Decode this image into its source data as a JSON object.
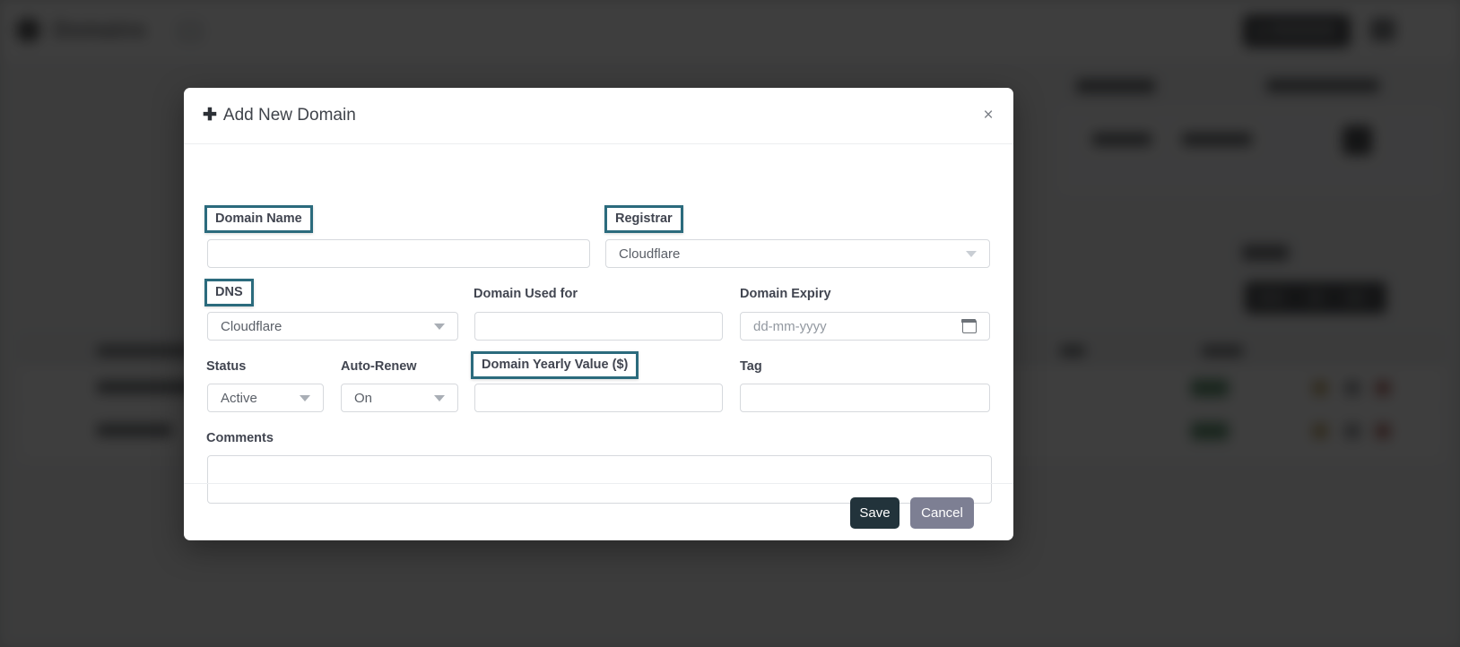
{
  "background": {
    "app_title": "Domains",
    "status_badge_color": "#1f7a3e",
    "primary_button_color": "#0d1117"
  },
  "modal": {
    "title": "Add New Domain",
    "title_icon": "plus-icon",
    "close_icon": "×",
    "fields": {
      "domain_name": {
        "label": "Domain Name",
        "value": "",
        "placeholder": "",
        "highlighted": true
      },
      "registrar": {
        "label": "Registrar",
        "value": "Cloudflare",
        "highlighted": true
      },
      "dns": {
        "label": "DNS",
        "value": "Cloudflare",
        "highlighted": true
      },
      "domain_used_for": {
        "label": "Domain Used for",
        "value": "",
        "placeholder": "",
        "highlighted": false
      },
      "domain_expiry": {
        "label": "Domain Expiry",
        "value": "",
        "placeholder": "dd-mm-yyyy",
        "highlighted": false
      },
      "status": {
        "label": "Status",
        "value": "Active",
        "highlighted": false
      },
      "auto_renew": {
        "label": "Auto-Renew",
        "value": "On",
        "highlighted": false
      },
      "domain_yearly_value": {
        "label": "Domain Yearly Value ($)",
        "value": "",
        "placeholder": "",
        "highlighted": true
      },
      "tag": {
        "label": "Tag",
        "value": "",
        "placeholder": "",
        "highlighted": false
      },
      "comments": {
        "label": "Comments",
        "value": "",
        "placeholder": "",
        "highlighted": false
      }
    },
    "buttons": {
      "save": "Save",
      "cancel": "Cancel"
    },
    "highlight_color": "#2b6b7d"
  }
}
